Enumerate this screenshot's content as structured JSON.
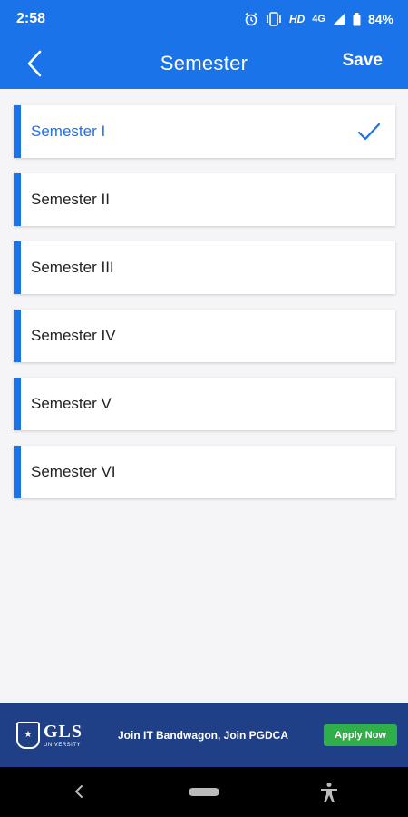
{
  "status_bar": {
    "time": "2:58",
    "hd": "HD",
    "network": "4G",
    "battery": "84%",
    "icons": [
      "alarm-icon",
      "vibrate-icon",
      "signal-icon",
      "battery-icon"
    ]
  },
  "app_bar": {
    "title": "Semester",
    "save_label": "Save",
    "back_icon": "chevron-left-icon"
  },
  "semesters": [
    {
      "label": "Semester I",
      "selected": true
    },
    {
      "label": "Semester II",
      "selected": false
    },
    {
      "label": "Semester III",
      "selected": false
    },
    {
      "label": "Semester IV",
      "selected": false
    },
    {
      "label": "Semester V",
      "selected": false
    },
    {
      "label": "Semester VI",
      "selected": false
    }
  ],
  "ad": {
    "logo_text": "GLS",
    "logo_subtext": "UNIVERSITY",
    "headline": "Join IT Bandwagon, Join PGDCA",
    "button_label": "Apply Now"
  },
  "colors": {
    "primary": "#1a73e8",
    "ad_background": "#1f3f86",
    "ad_button": "#2fae4a"
  }
}
